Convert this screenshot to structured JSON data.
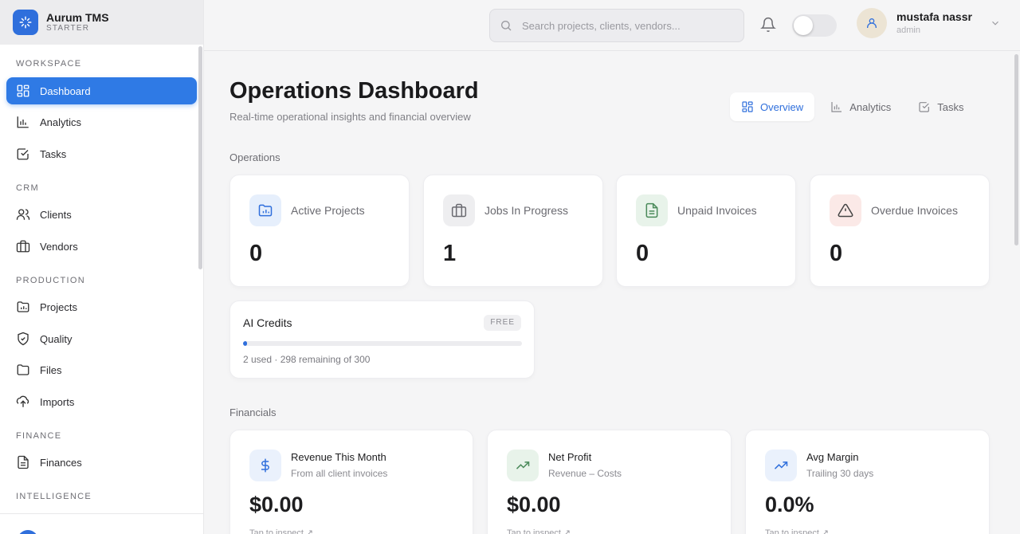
{
  "app": {
    "name": "Aurum TMS",
    "plan": "STARTER"
  },
  "sidebar": {
    "sections": [
      {
        "label": "WORKSPACE",
        "items": [
          {
            "label": "Dashboard",
            "icon": "dashboard-icon",
            "active": true
          },
          {
            "label": "Analytics",
            "icon": "bar-chart-icon"
          },
          {
            "label": "Tasks",
            "icon": "checkbox-icon"
          }
        ]
      },
      {
        "label": "CRM",
        "items": [
          {
            "label": "Clients",
            "icon": "users-icon"
          },
          {
            "label": "Vendors",
            "icon": "briefcase-icon"
          }
        ]
      },
      {
        "label": "PRODUCTION",
        "items": [
          {
            "label": "Projects",
            "icon": "folder-chart-icon"
          },
          {
            "label": "Quality",
            "icon": "shield-check-icon"
          },
          {
            "label": "Files",
            "icon": "folder-icon"
          },
          {
            "label": "Imports",
            "icon": "upload-cloud-icon"
          }
        ]
      },
      {
        "label": "FINANCE",
        "items": [
          {
            "label": "Finances",
            "icon": "document-icon"
          }
        ]
      },
      {
        "label": "INTELLIGENCE",
        "items": []
      }
    ]
  },
  "header": {
    "search_placeholder": "Search projects, clients, vendors...",
    "user": {
      "name": "mustafa nassr",
      "role": "admin"
    }
  },
  "main": {
    "title": "Operations Dashboard",
    "subtitle": "Real-time operational insights and financial overview",
    "tabs": [
      {
        "label": "Overview",
        "active": true
      },
      {
        "label": "Analytics"
      },
      {
        "label": "Tasks"
      }
    ],
    "operations_label": "Operations",
    "stats": [
      {
        "label": "Active Projects",
        "value": "0",
        "icon": "folder-chart-icon",
        "color": "#2f6fdc"
      },
      {
        "label": "Jobs In Progress",
        "value": "1",
        "icon": "briefcase-icon",
        "color": "#6a6a70"
      },
      {
        "label": "Unpaid Invoices",
        "value": "0",
        "icon": "invoice-icon",
        "color": "#4a8a5a"
      },
      {
        "label": "Overdue Invoices",
        "value": "0",
        "icon": "alert-triangle-icon",
        "color": "#b8504a"
      }
    ],
    "ai_credits": {
      "title": "AI Credits",
      "badge": "FREE",
      "used": 2,
      "total": 300,
      "usage_text": "2 used · 298 remaining of 300"
    },
    "financials_label": "Financials",
    "financials": [
      {
        "title": "Revenue This Month",
        "subtitle": "From all client invoices",
        "value": "$0.00",
        "link": "Tap to inspect ↗",
        "icon": "dollar-icon"
      },
      {
        "title": "Net Profit",
        "subtitle": "Revenue – Costs",
        "value": "$0.00",
        "link": "Tap to inspect ↗",
        "icon": "trending-up-icon"
      },
      {
        "title": "Avg Margin",
        "subtitle": "Trailing 30 days",
        "value": "0.0%",
        "link": "Tap to inspect ↗",
        "icon": "trending-up-icon"
      }
    ]
  }
}
